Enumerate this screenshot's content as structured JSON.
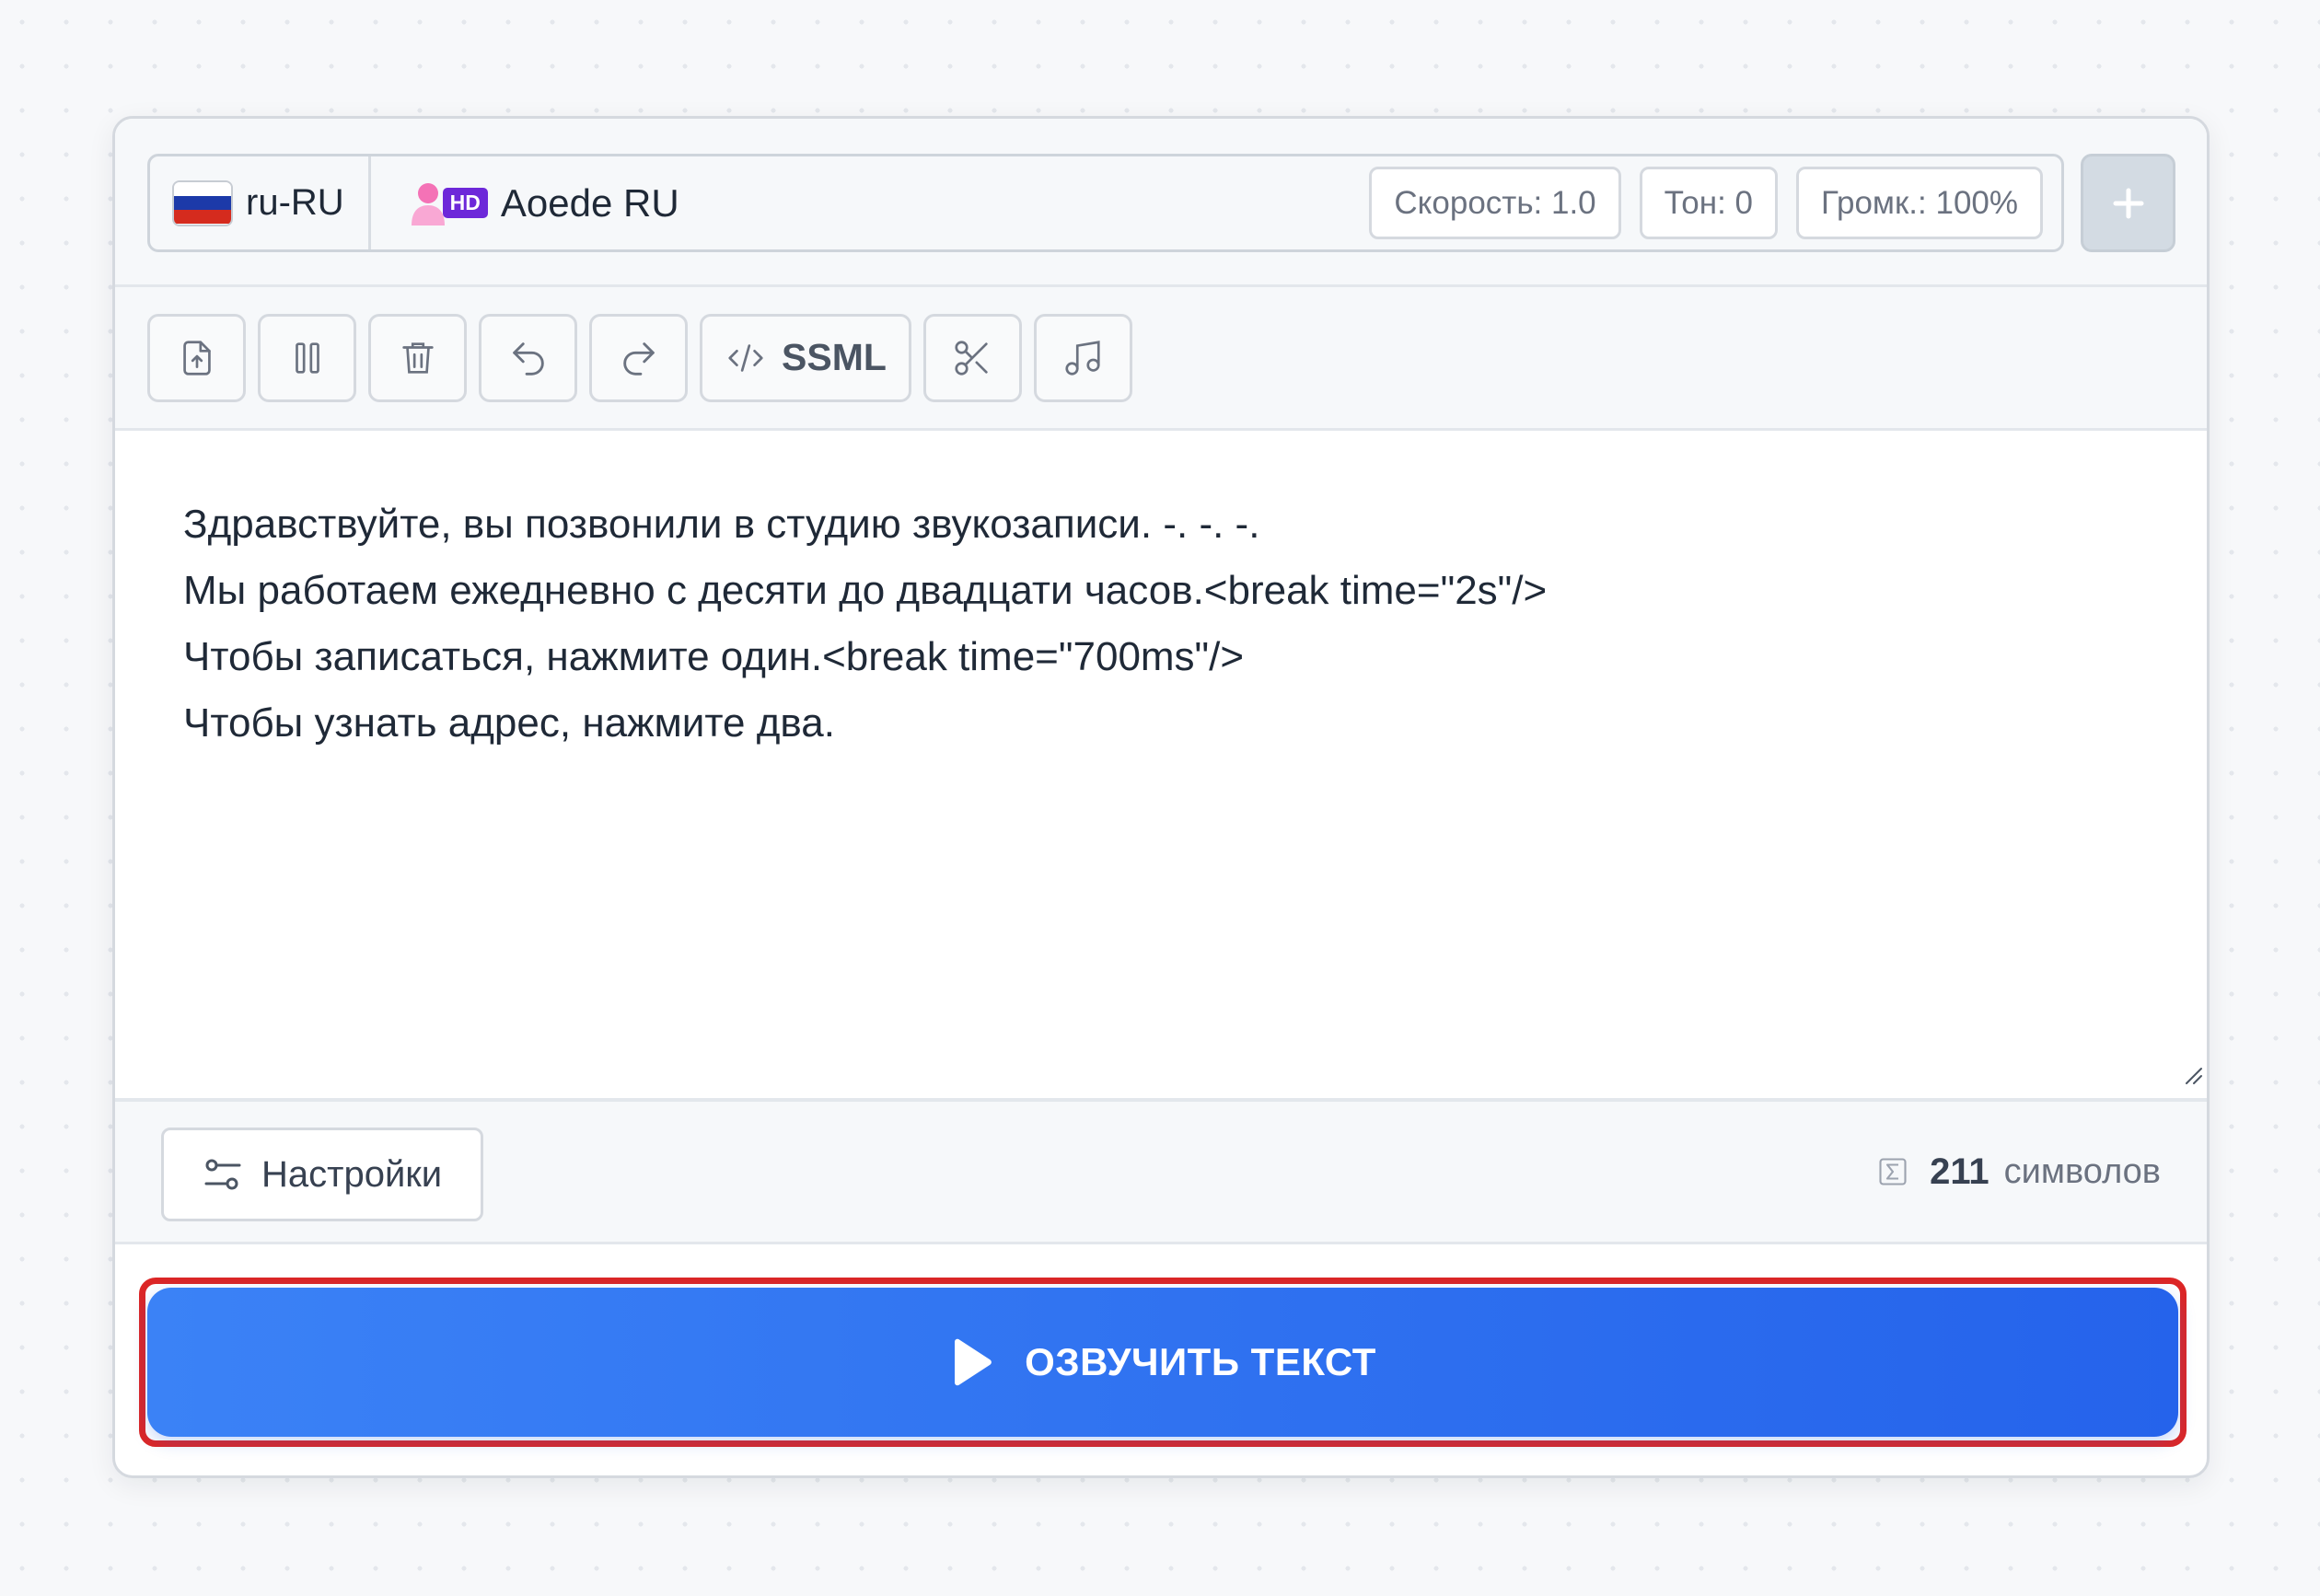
{
  "header": {
    "language": {
      "label": "ru-RU",
      "flag": "russia-flag",
      "flag_colors": [
        "#ffffff",
        "#1c3aa9",
        "#d52b1e"
      ]
    },
    "voice": {
      "badge": "HD",
      "name": "Aoede RU",
      "icon": "female-person-icon"
    },
    "speed_label": "Скорость: 1.0",
    "pitch_label": "Тон: 0",
    "volume_label": "Громк.: 100%",
    "add_icon": "plus-icon"
  },
  "toolbar": {
    "items": [
      {
        "name": "upload-file-button",
        "icon": "file-upload-icon"
      },
      {
        "name": "pause-button",
        "icon": "pause-icon"
      },
      {
        "name": "delete-button",
        "icon": "trash-icon"
      },
      {
        "name": "undo-button",
        "icon": "undo-icon"
      },
      {
        "name": "redo-button",
        "icon": "redo-icon"
      },
      {
        "name": "ssml-button",
        "icon": "code-icon"
      },
      {
        "name": "cut-button",
        "icon": "scissors-icon"
      },
      {
        "name": "music-button",
        "icon": "music-note-icon"
      }
    ],
    "ssml_label": "SSML"
  },
  "editor": {
    "lines": [
      "Здравствуйте, вы позвонили в студию звукозаписи. -. -. -.",
      "Мы работаем ежедневно с десяти до двадцати часов.<break time=\"2s\"/>",
      "Чтобы записаться, нажмите один.<break time=\"700ms\"/>",
      "Чтобы узнать адрес, нажмите два."
    ]
  },
  "footer": {
    "settings_label": "Настройки",
    "char_count": "211",
    "char_unit": "символов"
  },
  "speak_button": {
    "label": "ОЗВУЧИТЬ ТЕКСТ",
    "icon": "play-icon",
    "highlighted": true
  },
  "colors": {
    "accent": "#2563eb",
    "highlight": "#dc2626",
    "hd_badge": "#6d28d9"
  }
}
